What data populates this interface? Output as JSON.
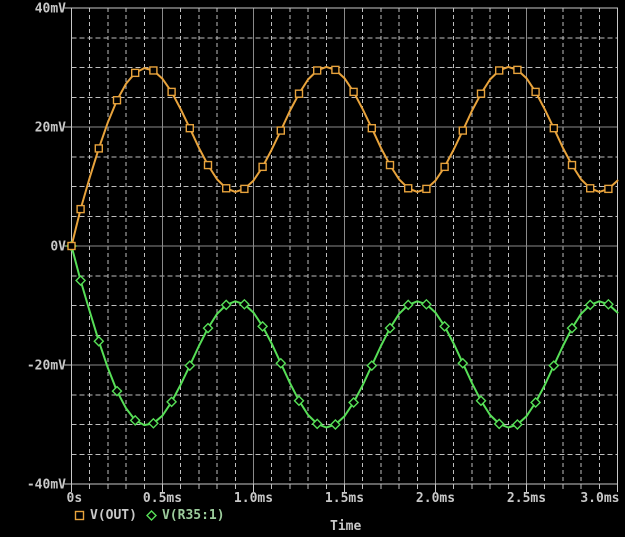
{
  "window": {
    "background": "#000000"
  },
  "chart_data": {
    "type": "line",
    "title": "",
    "xlabel": "Time",
    "xlim_ms": [
      0,
      3
    ],
    "ylim_mV": [
      -40,
      40
    ],
    "x_major_step_ms": 0.5,
    "x_minor_step_ms": 0.1,
    "y_major_step_mV": 20,
    "y_minor_step_mV": 5,
    "grid": "on",
    "legend_position": "bottom-left",
    "x_ticks": [
      {
        "t": 0,
        "label": "0s"
      },
      {
        "t": 0.5,
        "label": "0.5ms"
      },
      {
        "t": 1,
        "label": "1.0ms"
      },
      {
        "t": 1.5,
        "label": "1.5ms"
      },
      {
        "t": 2,
        "label": "2.0ms"
      },
      {
        "t": 2.5,
        "label": "2.5ms"
      },
      {
        "t": 3,
        "label": "3.0ms"
      }
    ],
    "y_ticks": [
      {
        "v": 40,
        "label": "40mV"
      },
      {
        "v": 20,
        "label": "20mV"
      },
      {
        "v": 0,
        "label": "0V"
      },
      {
        "v": -20,
        "label": "-20mV"
      },
      {
        "v": -40,
        "label": "-40mV"
      }
    ],
    "t_step_ms": 0.05,
    "marker_step": 2,
    "marker_phase": 1,
    "colors": {
      "background": "#000000",
      "frame": "#c8c8c8",
      "grid_major": "#8a8a8a",
      "grid_minor": "#bebebe",
      "text": "#c8c8c8"
    },
    "series": [
      {
        "id": "vout",
        "name": "V(OUT)",
        "color": "#e8a33c",
        "marker": "square",
        "legend_text_color": "#c8c8c8",
        "values": [
          0,
          6.2,
          11.5,
          16.4,
          20.8,
          24.5,
          27.3,
          29.1,
          29.9,
          29.5,
          28.1,
          25.9,
          23,
          19.8,
          16.5,
          13.6,
          11.2,
          9.7,
          9.1,
          9.6,
          11,
          13.3,
          16.2,
          19.4,
          22.7,
          25.6,
          28,
          29.5,
          30.1,
          29.6,
          28.2,
          25.9,
          23,
          19.8,
          16.5,
          13.6,
          11.2,
          9.7,
          9.1,
          9.6,
          11,
          13.3,
          16.2,
          19.4,
          22.7,
          25.6,
          28,
          29.5,
          30.1,
          29.6,
          28.2,
          25.9,
          23,
          19.8,
          16.5,
          13.6,
          11.2,
          9.7,
          9.1,
          9.6,
          11
        ]
      },
      {
        "id": "vr35-1",
        "name": "V(R35:1)",
        "color": "#57df57",
        "marker": "diamond",
        "legend_text_color": "#9ccc9c",
        "values": [
          0,
          -5.8,
          -11,
          -16,
          -20.5,
          -24.4,
          -27.3,
          -29.3,
          -30.1,
          -29.8,
          -28.5,
          -26.2,
          -23.3,
          -20.1,
          -16.8,
          -13.8,
          -11.4,
          -9.9,
          -9.3,
          -9.8,
          -11.2,
          -13.5,
          -16.4,
          -19.7,
          -23,
          -26,
          -28.4,
          -29.9,
          -30.5,
          -30,
          -28.6,
          -26.3,
          -23.4,
          -20.1,
          -16.8,
          -13.8,
          -11.4,
          -9.9,
          -9.3,
          -9.8,
          -11.2,
          -13.5,
          -16.4,
          -19.7,
          -23,
          -26,
          -28.4,
          -29.9,
          -30.5,
          -30,
          -28.6,
          -26.3,
          -23.4,
          -20.1,
          -16.8,
          -13.8,
          -11.4,
          -9.9,
          -9.3,
          -9.8,
          -11.2
        ]
      }
    ]
  }
}
